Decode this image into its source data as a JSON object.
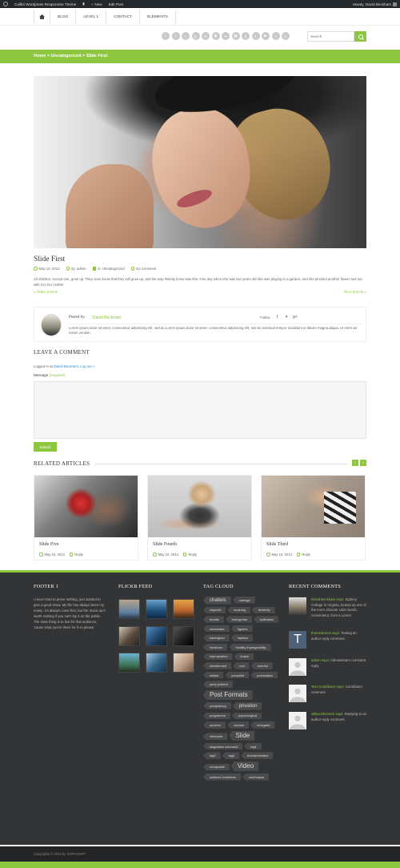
{
  "adminbar": {
    "site": "Calibri Wordpress Responsive Theme",
    "new": "New",
    "edit": "Edit Post",
    "howdy": "Howdy, David Beckham"
  },
  "nav": {
    "items": [
      "BLOG",
      "LEVEL 1",
      "CONTACT",
      "ELEMENTS"
    ]
  },
  "social": [
    "rss-icon",
    "facebook-icon",
    "twitter-icon",
    "pinterest-icon",
    "linkedin-icon",
    "dribbble-icon",
    "flickr-icon",
    "delicious-icon",
    "digg-icon",
    "tumblr-icon",
    "youtube-icon",
    "vimeo-icon",
    "skype-icon"
  ],
  "search": {
    "placeholder": "Search"
  },
  "breadcrumb": "Home > Uncategorized > Slide First",
  "post": {
    "title": "Slide First",
    "date": "May 10, 2013",
    "author": "by: admin",
    "category": "in: Uncategorized",
    "comments": "No Comment",
    "excerpt": "All children, except one, grow up. They soon know that they will grow up, and the way Wendy knew was this. One day when she was two years old she was playing in a garden, and she plucked another flower and ran with it to her mother.",
    "older": "« Older Article",
    "newer": "Next Article »"
  },
  "author_box": {
    "posted_by": "Posted by:",
    "name": "David Beckham",
    "follow": "Follow",
    "bio": "Lorem ipsum dolor sit amet, consectetur adipisicing elit, sed do.Lorem ipsum dolor sit amet, consectetur adipisicing elit, sed do eiusmod tempor incididunt ut labore magna aliqua. Ut enim ad minim veniam."
  },
  "comment_form": {
    "heading": "LEAVE A COMMENT",
    "logged_prefix": "Logged in as",
    "logged_user": "David Beckham",
    "logout": "Log out »",
    "message_label": "Message",
    "required": "(required)",
    "submit": "Submit"
  },
  "related": {
    "heading": "RELATED ARTICLES",
    "items": [
      {
        "title": "Slide Five",
        "date": "May 10, 2013",
        "reply": "Reply"
      },
      {
        "title": "Slide Fourth",
        "date": "May 10, 2013",
        "reply": "Reply"
      },
      {
        "title": "Slide Third",
        "date": "May 10, 2013",
        "reply": "Reply"
      }
    ]
  },
  "footer": {
    "col1_title": "FOOTER 1",
    "col1_text": "I never tried to prove nothing, just wanted to give a good show. My life has always been my music, it's always come first, but the music ain't worth nothing if you can't lay it on the public. The main thing is to live for that audience, 'cause what you're there for is to please",
    "flickr_title": "FLICKR FEED",
    "tags_title": "TAG CLOUD",
    "tags": [
      {
        "t": "chattels",
        "s": "med"
      },
      {
        "t": "carriage",
        "s": ""
      },
      {
        "t": "claycold",
        "s": ""
      },
      {
        "t": "crushing",
        "s": ""
      },
      {
        "t": "dexterity",
        "s": ""
      },
      {
        "t": "doodle",
        "s": ""
      },
      {
        "t": "energyman",
        "s": ""
      },
      {
        "t": "epithalast",
        "s": ""
      },
      {
        "t": "euboreater",
        "s": ""
      },
      {
        "t": "figurine",
        "s": ""
      },
      {
        "t": "habergeon",
        "s": ""
      },
      {
        "t": "hapless",
        "s": ""
      },
      {
        "t": "hartshorn",
        "s": ""
      },
      {
        "t": "hostility impregnability",
        "s": ""
      },
      {
        "t": "impropriation",
        "s": ""
      },
      {
        "t": "knave",
        "s": ""
      },
      {
        "t": "misinformed",
        "s": ""
      },
      {
        "t": "mot",
        "s": ""
      },
      {
        "t": "mornful",
        "s": ""
      },
      {
        "t": "outlaw",
        "s": ""
      },
      {
        "t": "pamphlet",
        "s": ""
      },
      {
        "t": "pneumatics",
        "s": ""
      },
      {
        "t": "party portiere",
        "s": ""
      },
      {
        "t": "Post Formats",
        "s": "big"
      },
      {
        "t": "precipitancy",
        "s": ""
      },
      {
        "t": "privation",
        "s": "med"
      },
      {
        "t": "programme",
        "s": ""
      },
      {
        "t": "psychological",
        "s": ""
      },
      {
        "t": "puncher",
        "s": ""
      },
      {
        "t": "ramose",
        "s": ""
      },
      {
        "t": "renegade",
        "s": ""
      },
      {
        "t": "retrocede",
        "s": ""
      },
      {
        "t": "Slide",
        "s": "big"
      },
      {
        "t": "stagnation unhorsed",
        "s": ""
      },
      {
        "t": "tag1",
        "s": ""
      },
      {
        "t": "tag2",
        "s": ""
      },
      {
        "t": "tag3",
        "s": ""
      },
      {
        "t": "thunderheaded",
        "s": ""
      },
      {
        "t": "unculpable",
        "s": ""
      },
      {
        "t": "Video",
        "s": "big"
      },
      {
        "t": "withered loneliness",
        "s": ""
      },
      {
        "t": "xanthopsia",
        "s": ""
      }
    ],
    "recent_title": "RECENT COMMENTS",
    "recent": [
      {
        "who": "David Beckham says:",
        "text": "Sydney College in Virginia, looked up one of the more obscure Latin words, consectetur, from a Lorem"
      },
      {
        "who": "themedemos says:",
        "text": "Testing an author reply comment."
      },
      {
        "who": "admin says:",
        "text": "Administrator comment reply."
      },
      {
        "who": "Test Contributor says:",
        "text": "Contributor comment"
      },
      {
        "who": "willyvonfresse2 says:",
        "text": "Replying to an author reply comment."
      }
    ],
    "copyright": "Copyrights © 2013 by XOPHOOPT"
  },
  "colors": {
    "accent": "#8dc63f",
    "footer_bg": "#333436"
  }
}
